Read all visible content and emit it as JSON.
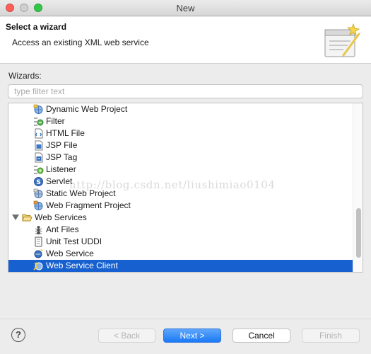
{
  "window": {
    "title": "New"
  },
  "header": {
    "title": "Select a wizard",
    "subtitle": "Access an existing XML web service"
  },
  "wizards_label": "Wizards:",
  "filter": {
    "value": "",
    "placeholder": "type filter text"
  },
  "tree": {
    "items": [
      {
        "label": "Dynamic Web Project",
        "icon": "dynamic-web-project-icon",
        "selected": false
      },
      {
        "label": "Filter",
        "icon": "filter-icon",
        "selected": false
      },
      {
        "label": "HTML File",
        "icon": "html-file-icon",
        "selected": false
      },
      {
        "label": "JSP File",
        "icon": "jsp-file-icon",
        "selected": false
      },
      {
        "label": "JSP Tag",
        "icon": "jsp-tag-icon",
        "selected": false
      },
      {
        "label": "Listener",
        "icon": "listener-icon",
        "selected": false
      },
      {
        "label": "Servlet",
        "icon": "servlet-icon",
        "selected": false
      },
      {
        "label": "Static Web Project",
        "icon": "static-web-project-icon",
        "selected": false
      },
      {
        "label": "Web Fragment Project",
        "icon": "web-fragment-project-icon",
        "selected": false
      },
      {
        "label": "Web Services",
        "icon": "folder-open-icon",
        "selected": false,
        "expanded": true
      },
      {
        "label": "Ant Files",
        "icon": "ant-files-icon",
        "selected": false
      },
      {
        "label": "Unit Test UDDI",
        "icon": "unit-test-uddi-icon",
        "selected": false
      },
      {
        "label": "Web Service",
        "icon": "web-service-icon",
        "selected": false
      },
      {
        "label": "Web Service Client",
        "icon": "web-service-client-icon",
        "selected": true
      }
    ]
  },
  "watermark": "http://blog.csdn.net/liushimiao0104",
  "buttons": {
    "help": "?",
    "back": "< Back",
    "next": "Next >",
    "cancel": "Cancel",
    "finish": "Finish"
  },
  "colors": {
    "selection": "#1660cf",
    "primary_button": "#1a7af7",
    "close": "#fc5f57",
    "maximize": "#33c748"
  }
}
